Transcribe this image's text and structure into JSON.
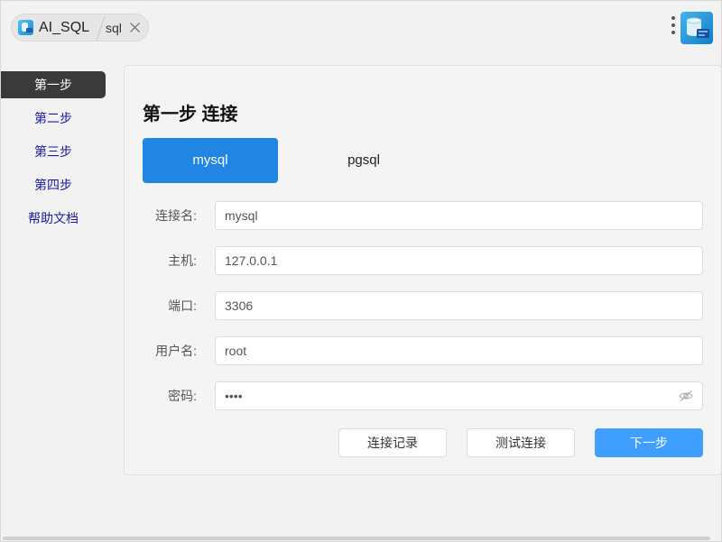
{
  "window": {
    "app_name": "AI_SQL",
    "tab_label": "sql"
  },
  "sidebar": {
    "items": [
      {
        "label": "第一步",
        "active": true
      },
      {
        "label": "第二步",
        "active": false
      },
      {
        "label": "第三步",
        "active": false
      },
      {
        "label": "第四步",
        "active": false
      },
      {
        "label": "帮助文档",
        "active": false
      }
    ]
  },
  "main": {
    "title": "第一步 连接",
    "db_tabs": [
      {
        "label": "mysql",
        "active": true
      },
      {
        "label": "pgsql",
        "active": false
      }
    ],
    "form": {
      "connection_name": {
        "label": "连接名:",
        "value": "mysql"
      },
      "host": {
        "label": "主机:",
        "value": "127.0.0.1"
      },
      "port": {
        "label": "端口:",
        "value": "3306"
      },
      "username": {
        "label": "用户名:",
        "value": "root"
      },
      "password": {
        "label": "密码:",
        "value": "root"
      }
    },
    "buttons": {
      "history": "连接记录",
      "test": "测试连接",
      "next": "下一步"
    }
  },
  "colors": {
    "accent": "#2185e3",
    "primary_button": "#409eff",
    "nav_active_bg": "#3a3a3a",
    "nav_link": "#1a1a9e"
  }
}
